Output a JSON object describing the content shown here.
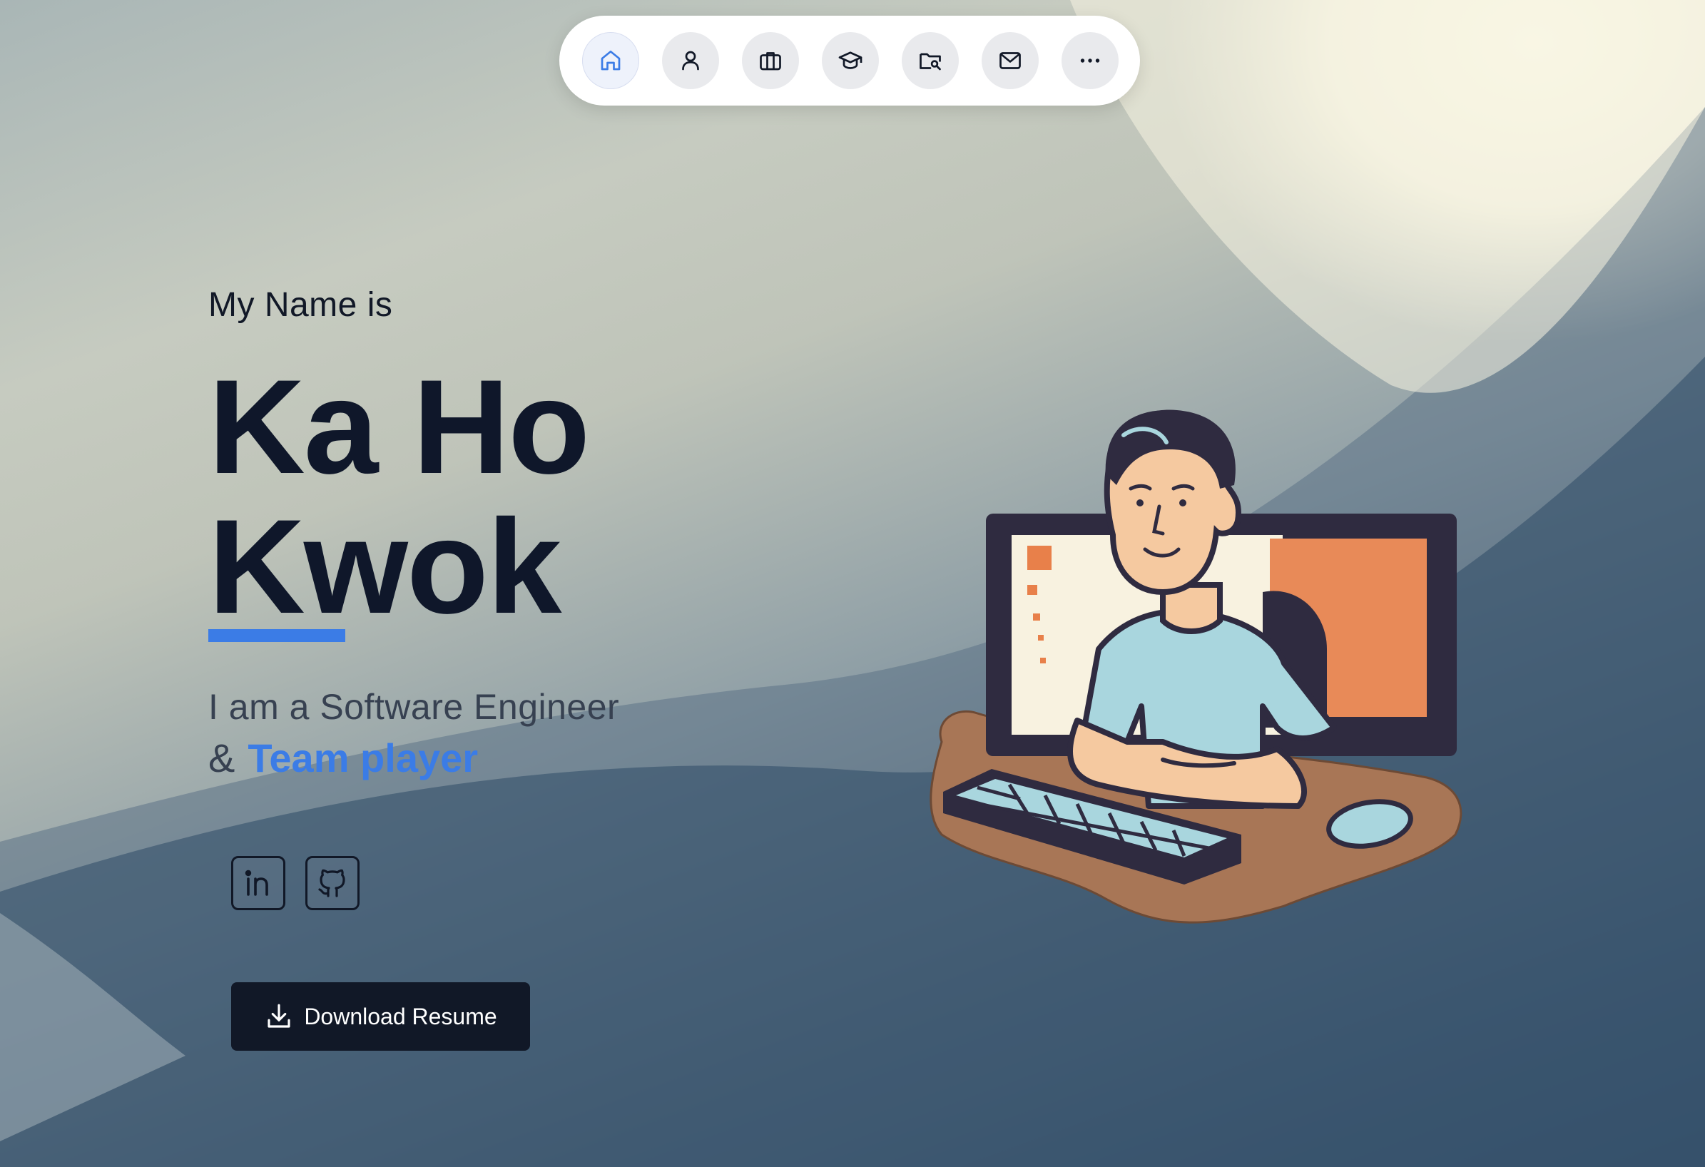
{
  "nav": {
    "items": [
      {
        "icon": "home-icon",
        "active": true
      },
      {
        "icon": "user-icon",
        "active": false
      },
      {
        "icon": "briefcase-icon",
        "active": false
      },
      {
        "icon": "graduation-cap-icon",
        "active": false
      },
      {
        "icon": "folder-search-icon",
        "active": false
      },
      {
        "icon": "mail-icon",
        "active": false
      },
      {
        "icon": "more-icon",
        "active": false
      }
    ]
  },
  "hero": {
    "intro": "My Name is",
    "name_line1": "Ka Ho",
    "name_line2": "Kwok",
    "role": "I am a Software Engineer",
    "tag_prefix": "&",
    "tag_highlight": "Team player"
  },
  "social": [
    {
      "icon": "linkedin-icon"
    },
    {
      "icon": "github-icon"
    }
  ],
  "cta": {
    "label": "Download Resume",
    "icon": "download-icon"
  },
  "colors": {
    "accent": "#3b7ce6",
    "text_dark": "#0f172a",
    "button_bg": "#111827"
  }
}
